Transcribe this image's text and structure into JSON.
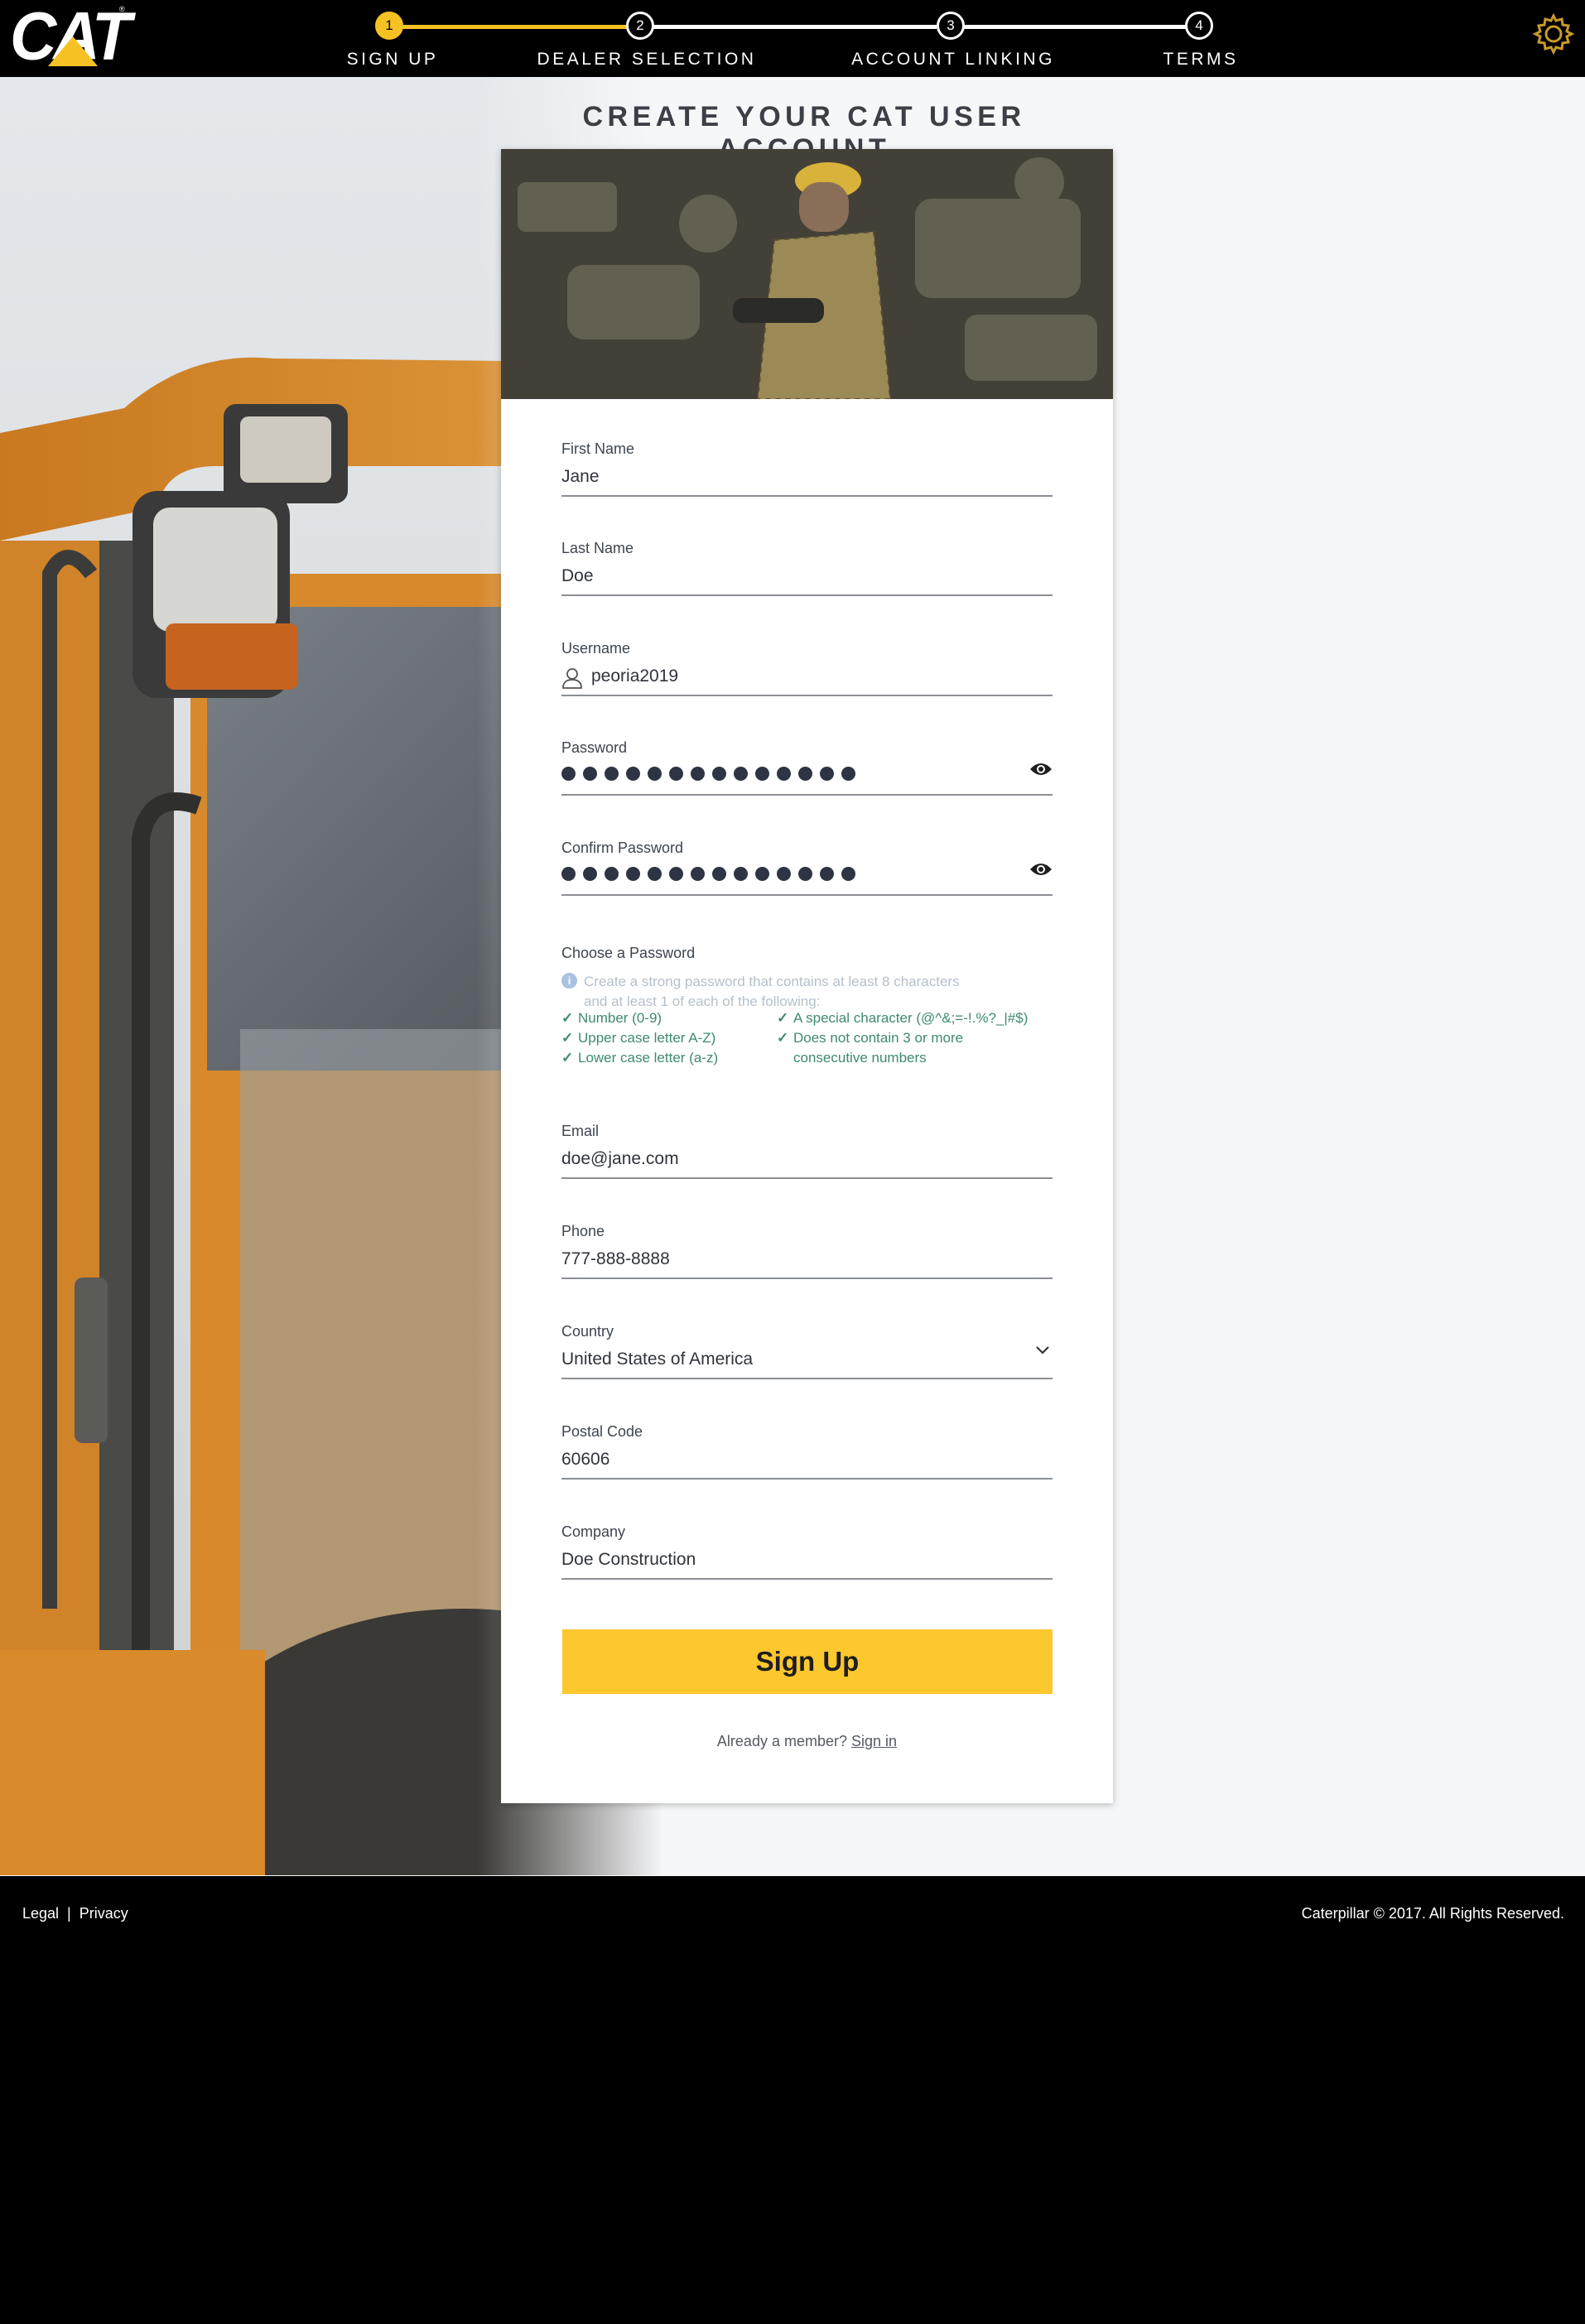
{
  "brand": {
    "logo_text": "CAT",
    "logo_mark": "®",
    "accent": "#f6c223"
  },
  "stepper": {
    "steps": [
      {
        "number": "1",
        "label": "SIGN UP",
        "state": "active"
      },
      {
        "number": "2",
        "label": "DEALER SELECTION",
        "state": "upcoming"
      },
      {
        "number": "3",
        "label": "ACCOUNT LINKING",
        "state": "upcoming"
      },
      {
        "number": "4",
        "label": "TERMS",
        "state": "upcoming"
      }
    ]
  },
  "header": {
    "settings_icon": "gear-icon"
  },
  "page": {
    "title": "CREATE YOUR CAT USER ACCOUNT"
  },
  "form": {
    "first_name": {
      "label": "First Name",
      "value": "Jane"
    },
    "last_name": {
      "label": "Last Name",
      "value": "Doe"
    },
    "username": {
      "label": "Username",
      "value": "peoria2019",
      "icon": "user-icon"
    },
    "password": {
      "label": "Password",
      "masked_length": 14,
      "toggle_icon": "eye-icon"
    },
    "confirm_password": {
      "label": "Confirm Password",
      "masked_length": 14,
      "toggle_icon": "eye-icon"
    },
    "password_rules": {
      "label": "Choose a Password",
      "hint": "Create a strong password that contains at least 8 characters and at least 1 of each of the following:",
      "rules": [
        "Number (0-9)",
        "Upper case letter A-Z)",
        "Lower case letter (a-z)",
        "A special character (@^&;=-!.%?_|#$)",
        "Does not contain 3 or more",
        "consecutive numbers"
      ]
    },
    "email": {
      "label": "Email",
      "value": "doe@jane.com"
    },
    "phone": {
      "label": "Phone",
      "value": "777-888-8888"
    },
    "country": {
      "label": "Country",
      "value": "United States of America"
    },
    "postal_code": {
      "label": "Postal Code",
      "value": "60606"
    },
    "company": {
      "label": "Company",
      "value": "Doe Construction"
    },
    "submit_label": "Sign Up",
    "already_member": "Already a member?",
    "sign_in_link": "Sign in"
  },
  "footer": {
    "legal": "Legal",
    "separator": "|",
    "privacy": "Privacy",
    "copyright": "Caterpillar © 2017. All Rights Reserved."
  }
}
